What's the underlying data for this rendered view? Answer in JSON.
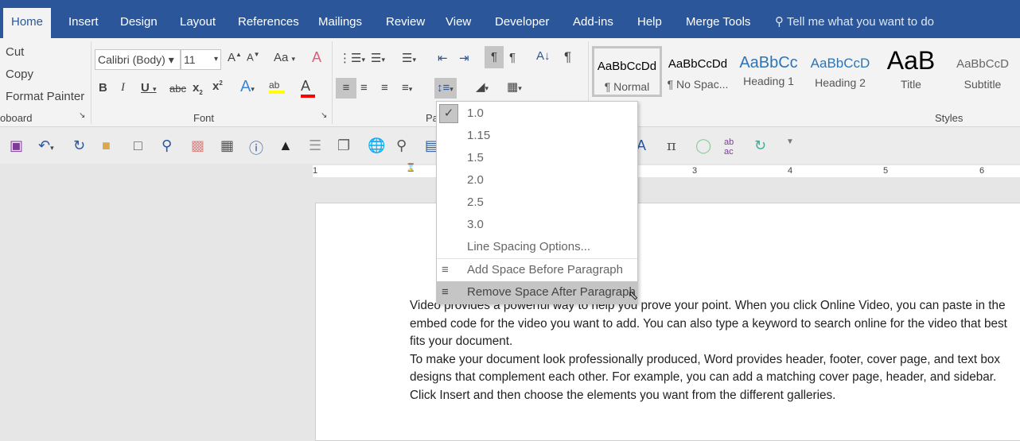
{
  "tabs": [
    "Home",
    "Insert",
    "Design",
    "Layout",
    "References",
    "Mailings",
    "Review",
    "View",
    "Developer",
    "Add-ins",
    "Help",
    "Merge Tools"
  ],
  "tell_me": "Tell me what you want to do",
  "clipboard": {
    "cut": "Cut",
    "copy": "Copy",
    "format_painter": "Format Painter",
    "label": "oboard"
  },
  "font": {
    "name": "Calibri (Body)",
    "size": "11",
    "label": "Font",
    "change_case": "Aa"
  },
  "paragraph": {
    "label": "Pa"
  },
  "styles": {
    "label": "Styles",
    "items": [
      {
        "preview": "AaBbCcDd",
        "name": "¶ Normal"
      },
      {
        "preview": "AaBbCcDd",
        "name": "¶ No Spac..."
      },
      {
        "preview": "AaBbCc",
        "name": "Heading 1"
      },
      {
        "preview": "AaBbCcD",
        "name": "Heading 2"
      },
      {
        "preview": "AaB",
        "name": "Title"
      },
      {
        "preview": "AaBbCcD",
        "name": "Subtitle"
      }
    ]
  },
  "ruler": [
    "1",
    "3",
    "4",
    "5",
    "6"
  ],
  "menu": {
    "options": [
      "1.0",
      "1.15",
      "1.5",
      "2.0",
      "2.5",
      "3.0"
    ],
    "selected": "1.0",
    "line_spacing_options": "Line Spacing Options...",
    "add_before": "Add Space Before Paragraph",
    "remove_after": "Remove Space After Paragraph"
  },
  "document": {
    "paragraphs": [
      "Video provides a powerful way to help you prove your point. When you click Online Video, you can paste in the embed code for the video you want to add. You can also type a keyword to search online for the video that best fits your document.",
      "To make your document look professionally produced, Word provides header, footer, cover page, and text box designs that complement each other. For example, you can add a matching cover page, header, and sidebar. Click Insert and then choose the elements you want from the different galleries."
    ]
  },
  "colors": {
    "accent": "#2b579a",
    "highlight": "#ffff00",
    "font_color": "#ff0000"
  }
}
